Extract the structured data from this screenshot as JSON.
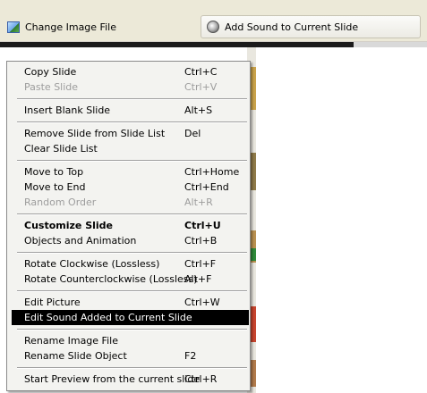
{
  "toolbar": {
    "change_image_label": "Change Image File",
    "add_sound_label": "Add Sound to Current Slide"
  },
  "menu": {
    "items": [
      {
        "label": "Copy Slide",
        "shortcut": "Ctrl+C",
        "enabled": true,
        "bold": false,
        "selected": false
      },
      {
        "label": "Paste Slide",
        "shortcut": "Ctrl+V",
        "enabled": false,
        "bold": false,
        "selected": false
      },
      {
        "label": "Insert Blank Slide",
        "shortcut": "Alt+S",
        "enabled": true,
        "bold": false,
        "selected": false
      },
      {
        "label": "Remove Slide from Slide List",
        "shortcut": "Del",
        "enabled": true,
        "bold": false,
        "selected": false
      },
      {
        "label": "Clear Slide List",
        "shortcut": "",
        "enabled": true,
        "bold": false,
        "selected": false
      },
      {
        "label": "Move to Top",
        "shortcut": "Ctrl+Home",
        "enabled": true,
        "bold": false,
        "selected": false
      },
      {
        "label": "Move to End",
        "shortcut": "Ctrl+End",
        "enabled": true,
        "bold": false,
        "selected": false
      },
      {
        "label": "Random Order",
        "shortcut": "Alt+R",
        "enabled": false,
        "bold": false,
        "selected": false
      },
      {
        "label": "Customize Slide",
        "shortcut": "Ctrl+U",
        "enabled": true,
        "bold": true,
        "selected": false
      },
      {
        "label": "Objects and Animation",
        "shortcut": "Ctrl+B",
        "enabled": true,
        "bold": false,
        "selected": false
      },
      {
        "label": "Rotate Clockwise (Lossless)",
        "shortcut": "Ctrl+F",
        "enabled": true,
        "bold": false,
        "selected": false
      },
      {
        "label": "Rotate Counterclockwise (Lossless)",
        "shortcut": "Alt+F",
        "enabled": true,
        "bold": false,
        "selected": false
      },
      {
        "label": "Edit Picture",
        "shortcut": "Ctrl+W",
        "enabled": true,
        "bold": false,
        "selected": false
      },
      {
        "label": "Edit Sound Added to Current Slide",
        "shortcut": "",
        "enabled": true,
        "bold": false,
        "selected": true
      },
      {
        "label": "Rename Image File",
        "shortcut": "",
        "enabled": true,
        "bold": false,
        "selected": false
      },
      {
        "label": "Rename Slide Object",
        "shortcut": "F2",
        "enabled": true,
        "bold": false,
        "selected": false
      },
      {
        "label": "Start Preview from the current slide",
        "shortcut": "Ctrl+R",
        "enabled": true,
        "bold": false,
        "selected": false
      }
    ]
  },
  "colors": {
    "menu_background": "#f3f3f0",
    "selected_background": "#000000",
    "selected_text": "#ffffff",
    "disabled_text": "#9d9d9d"
  }
}
